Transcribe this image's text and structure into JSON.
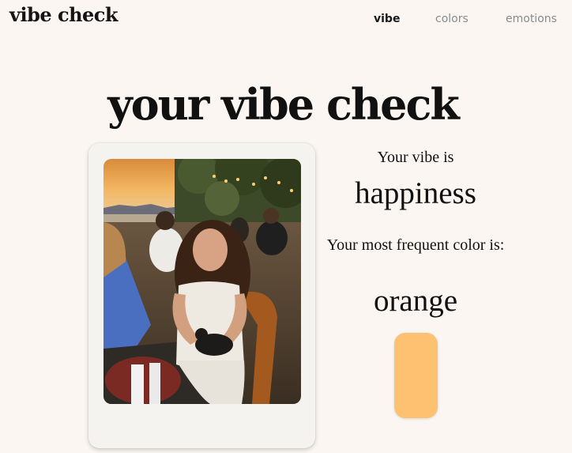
{
  "header": {
    "logo": "vibe check",
    "nav": [
      {
        "label": "vibe",
        "active": true
      },
      {
        "label": "colors",
        "active": false
      },
      {
        "label": "emotions",
        "active": false
      }
    ]
  },
  "main": {
    "title": "your vibe check",
    "vibe_label": "Your vibe is",
    "vibe_value": "happiness",
    "color_label": "Your most frequent color is:",
    "color_value": "orange",
    "swatch_color": "#fec171"
  },
  "colors": {
    "background": "#fbf6f2",
    "card": "#f5f3f0",
    "nav_active": "#1a1a1a",
    "nav_inactive": "#8b8b8b"
  }
}
